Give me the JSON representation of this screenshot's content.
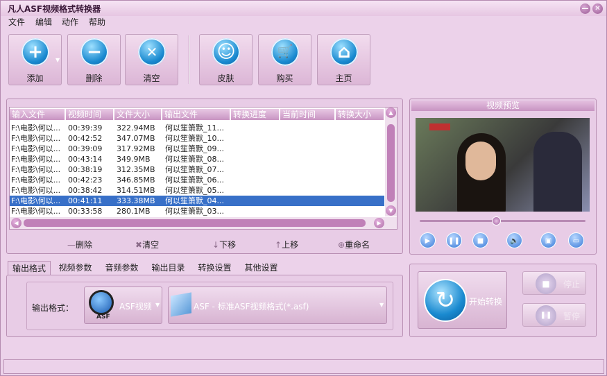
{
  "window": {
    "title": "凡人ASF视频格式转换器",
    "minimize": "—",
    "close": "✕"
  },
  "menu": [
    "文件",
    "编辑",
    "动作",
    "帮助"
  ],
  "toolbar": [
    {
      "label": "添加",
      "icon": "plus-icon",
      "glyph": "+"
    },
    {
      "label": "删除",
      "icon": "minus-icon",
      "glyph": "−"
    },
    {
      "label": "清空",
      "icon": "clear-icon",
      "glyph": "✕"
    },
    {
      "label": "皮肤",
      "icon": "smiley-icon",
      "glyph": "☺"
    },
    {
      "label": "购买",
      "icon": "cart-icon",
      "glyph": "🛒"
    },
    {
      "label": "主页",
      "icon": "home-icon",
      "glyph": "⌂"
    }
  ],
  "filelist": {
    "columns": [
      "输入文件",
      "视频时间",
      "文件大小",
      "输出文件",
      "转换进度",
      "当前时间",
      "转换大小"
    ],
    "rows": [
      [
        "F:\\电影\\何以...",
        "00:39:39",
        "322.94MB",
        "何以笙箫默_11..."
      ],
      [
        "F:\\电影\\何以...",
        "00:42:52",
        "347.07MB",
        "何以笙箫默_10..."
      ],
      [
        "F:\\电影\\何以...",
        "00:39:09",
        "317.92MB",
        "何以笙箫默_09..."
      ],
      [
        "F:\\电影\\何以...",
        "00:43:14",
        "349.9MB",
        "何以笙箫默_08..."
      ],
      [
        "F:\\电影\\何以...",
        "00:38:19",
        "312.35MB",
        "何以笙箫默_07..."
      ],
      [
        "F:\\电影\\何以...",
        "00:42:23",
        "346.85MB",
        "何以笙箫默_06..."
      ],
      [
        "F:\\电影\\何以...",
        "00:38:42",
        "314.51MB",
        "何以笙箫默_05..."
      ],
      [
        "F:\\电影\\何以...",
        "00:41:11",
        "333.38MB",
        "何以笙箫默_04..."
      ],
      [
        "F:\\电影\\何以...",
        "00:33:58",
        "280.1MB",
        "何以笙箫默_03..."
      ]
    ],
    "selected_index": 7
  },
  "list_actions": [
    {
      "label": "删除",
      "glyph": "—"
    },
    {
      "label": "清空",
      "glyph": "✖"
    },
    {
      "label": "下移",
      "glyph": "↓"
    },
    {
      "label": "上移",
      "glyph": "↑"
    },
    {
      "label": "重命名",
      "glyph": "⊕"
    }
  ],
  "preview": {
    "title": "视频预览",
    "seek_fraction": 0.46
  },
  "player_controls": [
    {
      "name": "play-button",
      "glyph": "▶"
    },
    {
      "name": "pause-button",
      "glyph": "❚❚"
    },
    {
      "name": "stop-button",
      "glyph": "■"
    },
    {
      "name": "volume-button",
      "glyph": "🔈"
    },
    {
      "name": "snapshot-button",
      "glyph": "▣"
    },
    {
      "name": "folder-button",
      "glyph": "▭"
    }
  ],
  "tabs": [
    "输出格式",
    "视频参数",
    "音频参数",
    "输出目录",
    "转换设置",
    "其他设置"
  ],
  "active_tab": 0,
  "output": {
    "label": "输出格式：",
    "format_name": "ASF视频",
    "format_badge": "ASF",
    "preset": "ASF - 标准ASF视频格式(*.asf)"
  },
  "convert": {
    "start": "开始转换",
    "stop": "停止",
    "pause": "暂停"
  },
  "status_text": "",
  "colors": {
    "accent": "#3870c8",
    "panel": "#e8cce6",
    "header": "#c894c2"
  }
}
